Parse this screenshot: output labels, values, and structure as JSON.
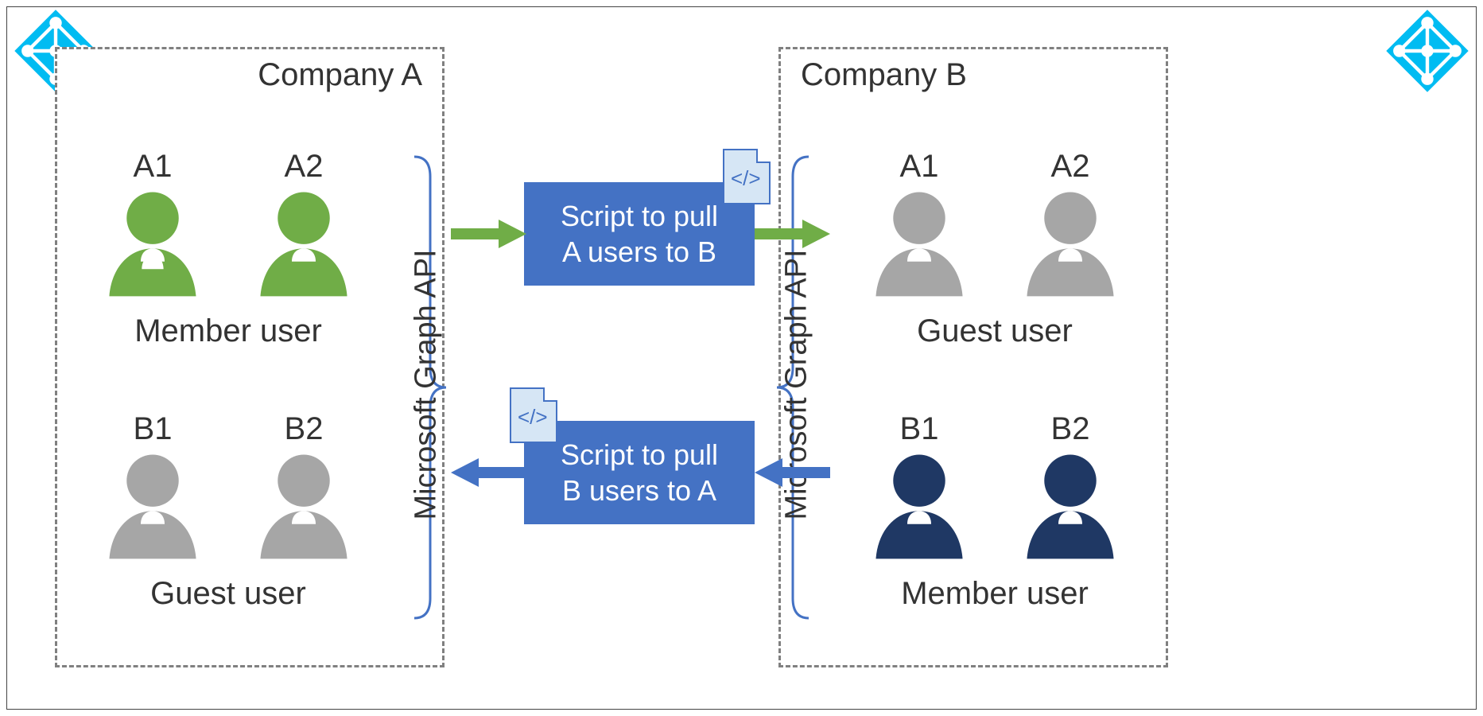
{
  "companyA": {
    "title": "Company A",
    "api_label": "Microsoft Graph API",
    "top_group": {
      "users": [
        {
          "id": "A1",
          "color": "#70ad47"
        },
        {
          "id": "A2",
          "color": "#70ad47"
        }
      ],
      "label": "Member user"
    },
    "bottom_group": {
      "users": [
        {
          "id": "B1",
          "color": "#a6a6a6"
        },
        {
          "id": "B2",
          "color": "#a6a6a6"
        }
      ],
      "label": "Guest user"
    }
  },
  "companyB": {
    "title": "Company B",
    "api_label": "Microsoft Graph API",
    "top_group": {
      "users": [
        {
          "id": "A1",
          "color": "#a6a6a6"
        },
        {
          "id": "A2",
          "color": "#a6a6a6"
        }
      ],
      "label": "Guest user"
    },
    "bottom_group": {
      "users": [
        {
          "id": "B1",
          "color": "#1f3864"
        },
        {
          "id": "B2",
          "color": "#1f3864"
        }
      ],
      "label": "Member user"
    }
  },
  "scripts": {
    "toB": {
      "line1": "Script to pull",
      "line2": "A users to B"
    },
    "toA": {
      "line1": "Script to pull",
      "line2": "B users to A"
    }
  },
  "colors": {
    "green_arrow": "#70ad47",
    "blue_arrow": "#4472c4",
    "aad_logo": "#00bcf2",
    "bracket": "#4472c4"
  },
  "doc_glyph": "</>"
}
